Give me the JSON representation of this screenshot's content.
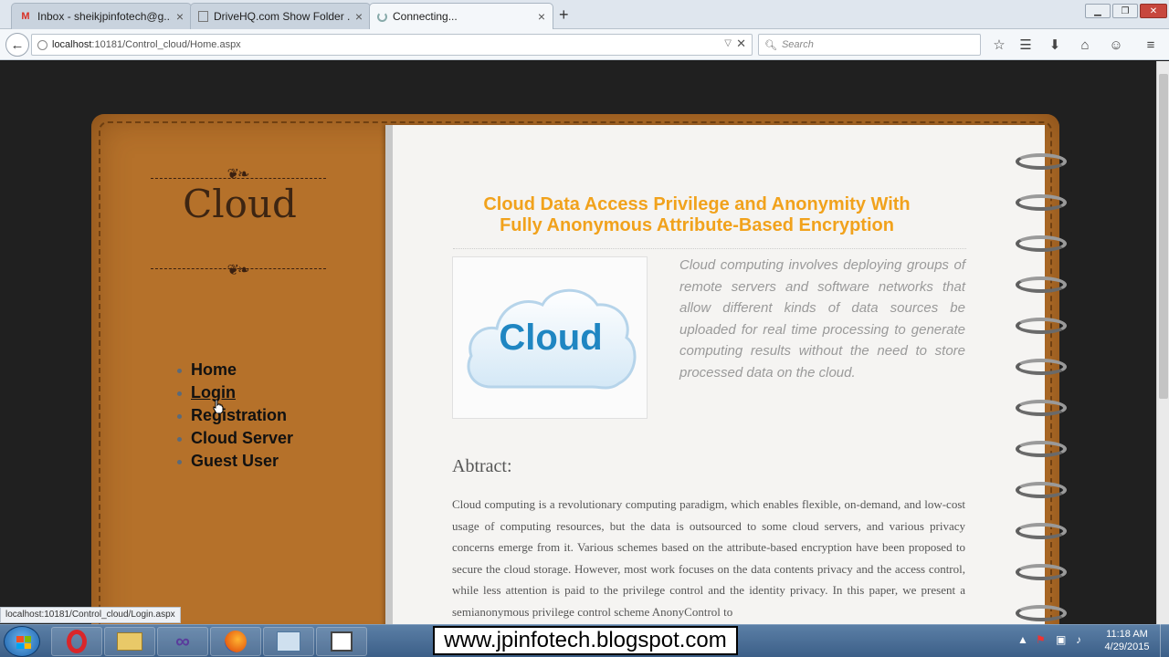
{
  "browser": {
    "tabs": [
      {
        "icon": "gmail-icon",
        "title": "Inbox - sheikjpinfotech@g...",
        "close": "×"
      },
      {
        "icon": "page-icon",
        "title": "DriveHQ.com Show Folder ...",
        "close": "×"
      },
      {
        "icon": "loading-icon",
        "title": "Connecting...",
        "close": "×"
      }
    ],
    "new_tab": "+",
    "window_controls": {
      "minimize": "▁",
      "maximize": "❐",
      "close": "✕"
    },
    "url_host": "localhost",
    "url_path": ":10181/Control_cloud/Home.aspx",
    "search_placeholder": "Search",
    "toolbar_icons": [
      "star-icon",
      "reading-list-icon",
      "download-icon",
      "home-icon",
      "chat-icon",
      "menu-icon"
    ]
  },
  "site": {
    "brand": "Cloud",
    "ornament": "❦❧",
    "nav": [
      "Home",
      "Login",
      "Registration",
      "Cloud Server",
      "Guest User"
    ],
    "title_line1": "Cloud Data Access Privilege and Anonymity With",
    "title_line2": "Fully Anonymous Attribute-Based Encryption",
    "image_text": "Cloud",
    "intro": "Cloud computing involves deploying groups of remote servers and software networks that allow different kinds of data sources be uploaded for real time processing to generate computing results without the need to store processed data on the cloud.",
    "abstract_heading": "Abtract:",
    "abstract_body": "Cloud computing is a revolutionary computing paradigm, which enables flexible, on-demand, and low-cost usage of computing resources, but the data is outsourced to some cloud servers, and various privacy concerns emerge from it. Various schemes based on the attribute-based encryption have been proposed to secure the cloud storage. However, most work focuses on the data contents privacy and the access control, while less attention is paid to the privilege control and the identity privacy. In this paper, we present a semianonymous privilege control scheme AnonyControl to"
  },
  "status_tip": "localhost:10181/Control_cloud/Login.aspx",
  "taskbar": {
    "watermark": "www.jpinfotech.blogspot.com",
    "time": "11:18 AM",
    "date": "4/29/2015",
    "apps": [
      "opera-icon",
      "file-explorer-icon",
      "visual-studio-icon",
      "firefox-icon",
      "network-icon",
      "window-icon"
    ]
  }
}
